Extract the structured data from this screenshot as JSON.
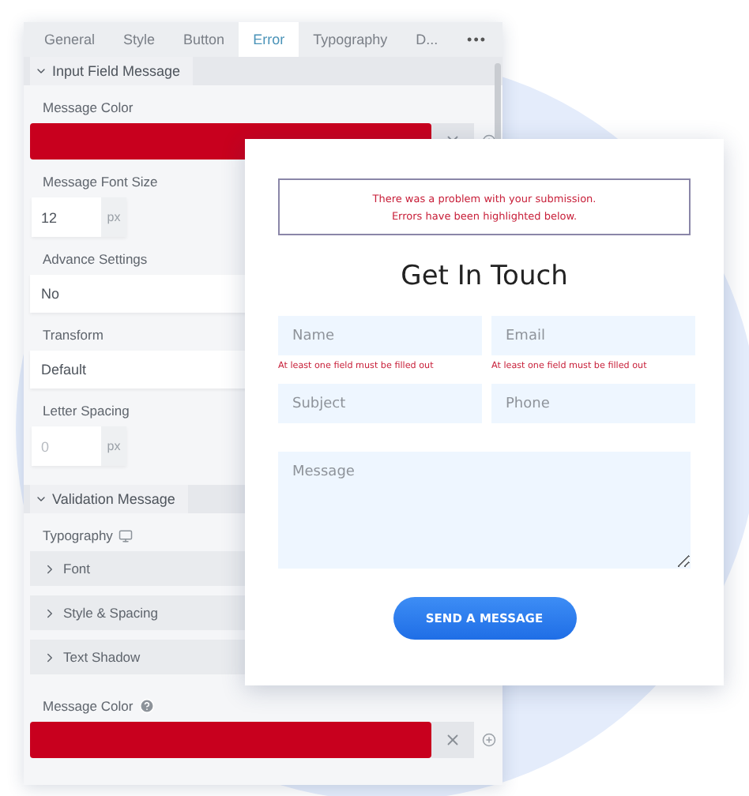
{
  "settings_panel": {
    "tabs": [
      {
        "label": "General",
        "selected": false
      },
      {
        "label": "Style",
        "selected": false
      },
      {
        "label": "Button",
        "selected": false
      },
      {
        "label": "Error",
        "selected": true
      },
      {
        "label": "Typography",
        "selected": false
      },
      {
        "label": "D...",
        "selected": false
      }
    ],
    "more_button": "•••",
    "sections": [
      {
        "title": "Input Field Message",
        "expanded": true,
        "fields": [
          {
            "kind": "color",
            "label": "Message Color",
            "color": "#c8001e"
          },
          {
            "kind": "number",
            "label": "Message Font Size",
            "value": "12",
            "unit": "px"
          },
          {
            "kind": "select",
            "label": "Advance Settings",
            "value": "No"
          },
          {
            "kind": "select",
            "label": "Transform",
            "value": "Default"
          },
          {
            "kind": "number",
            "label": "Letter Spacing",
            "placeholder": "0",
            "unit": "px"
          }
        ]
      },
      {
        "title": "Validation Message",
        "expanded": true,
        "fields": [
          {
            "kind": "group",
            "label": "Typography",
            "items": [
              {
                "label": "Font",
                "expanded": false
              },
              {
                "label": "Style & Spacing",
                "expanded": false
              },
              {
                "label": "Text Shadow",
                "expanded": false
              }
            ]
          },
          {
            "kind": "color",
            "label": "Message Color",
            "help": true,
            "color": "#c8001e"
          }
        ]
      }
    ]
  },
  "form": {
    "alert": [
      "There was a problem with your submission.",
      "Errors have been highlighted below."
    ],
    "title": "Get In Touch",
    "fields": [
      {
        "placeholder": "Name",
        "error": "At least one field must be filled out"
      },
      {
        "placeholder": "Email",
        "error": "At least one field must be filled out"
      },
      {
        "placeholder": "Subject"
      },
      {
        "placeholder": "Phone"
      }
    ],
    "message": {
      "placeholder": "Message"
    },
    "submit": "SEND A MESSAGE"
  }
}
